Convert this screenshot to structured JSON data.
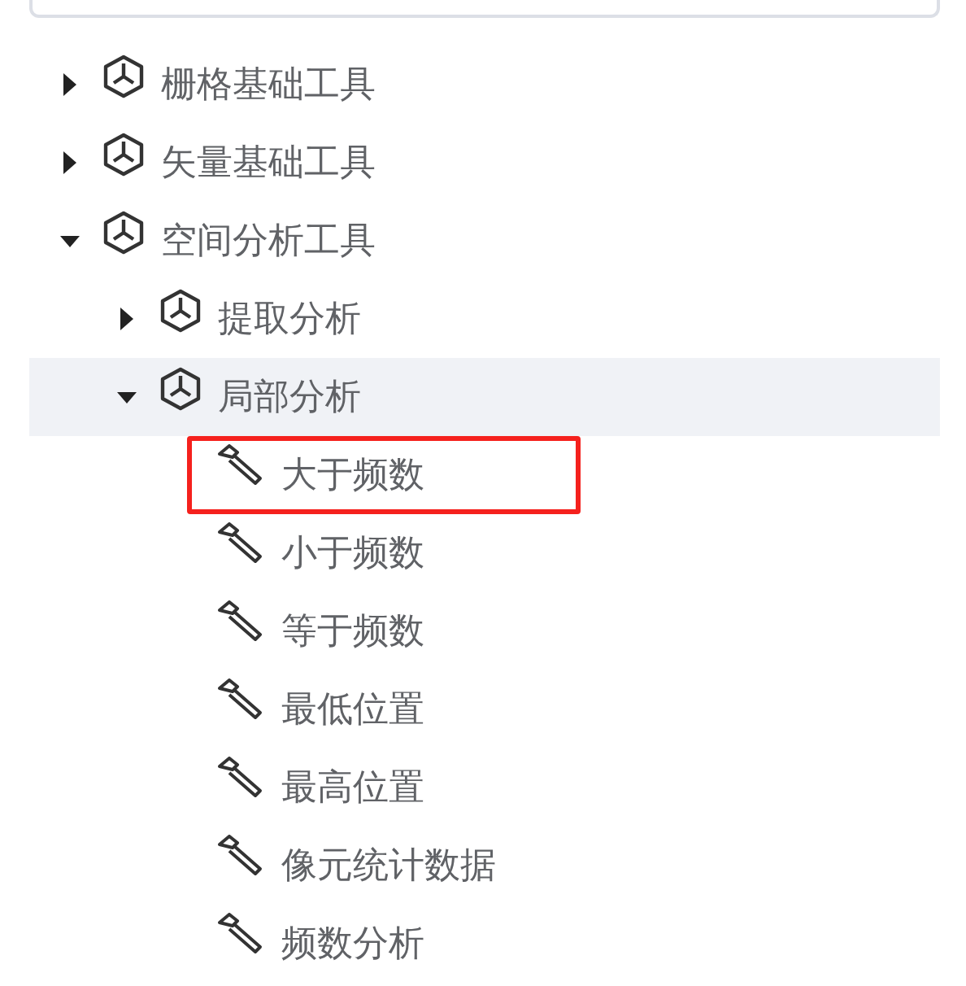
{
  "tree": [
    {
      "label": "栅格基础工具",
      "kind": "toolbox",
      "expanded": false,
      "hovered": false,
      "marked": false
    },
    {
      "label": "矢量基础工具",
      "kind": "toolbox",
      "expanded": false,
      "hovered": false,
      "marked": false
    },
    {
      "label": "空间分析工具",
      "kind": "toolbox",
      "expanded": true,
      "hovered": false,
      "marked": false,
      "children": [
        {
          "label": "提取分析",
          "kind": "toolbox",
          "expanded": false,
          "hovered": false,
          "marked": false
        },
        {
          "label": "局部分析",
          "kind": "toolbox",
          "expanded": true,
          "hovered": true,
          "marked": false,
          "children": [
            {
              "label": "大于频数",
              "kind": "tool",
              "hovered": false,
              "marked": true
            },
            {
              "label": "小于频数",
              "kind": "tool",
              "hovered": false,
              "marked": false
            },
            {
              "label": "等于频数",
              "kind": "tool",
              "hovered": false,
              "marked": false
            },
            {
              "label": "最低位置",
              "kind": "tool",
              "hovered": false,
              "marked": false
            },
            {
              "label": "最高位置",
              "kind": "tool",
              "hovered": false,
              "marked": false
            },
            {
              "label": "像元统计数据",
              "kind": "tool",
              "hovered": false,
              "marked": false
            },
            {
              "label": "频数分析",
              "kind": "tool",
              "hovered": false,
              "marked": false
            }
          ]
        }
      ]
    }
  ]
}
